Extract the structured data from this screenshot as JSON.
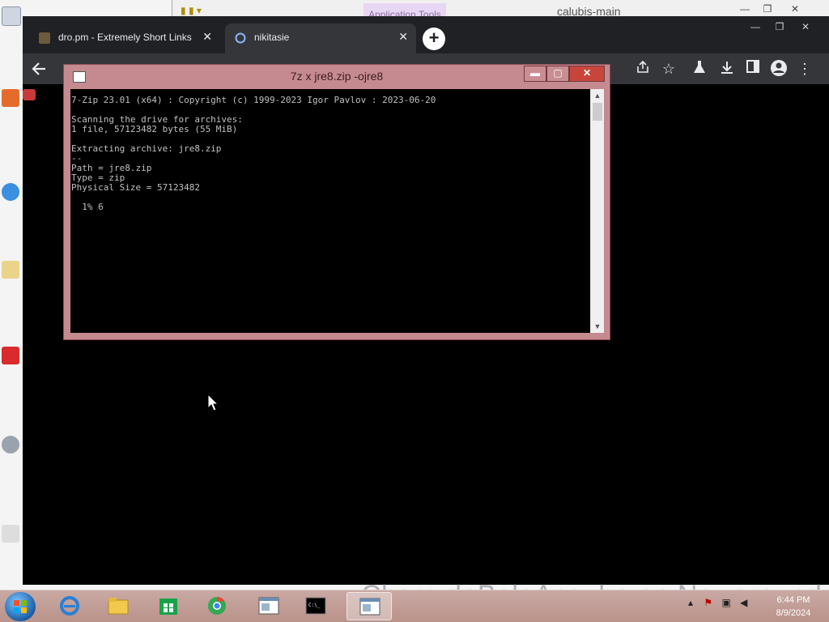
{
  "explorer": {
    "contextual_tab": "Application Tools",
    "title": "calubis-main"
  },
  "browser": {
    "tabs": [
      {
        "title": "dro.pm - Extremely Short Links",
        "active": false
      },
      {
        "title": "nikitasie",
        "active": true
      }
    ],
    "new_tab_symbol": "+",
    "close_symbol": "✕"
  },
  "console_window": {
    "title": "7z  x jre8.zip -ojre8",
    "output": "7-Zip 23.01 (x64) : Copyright (c) 1999-2023 Igor Pavlov : 2023-06-20\n\nScanning the drive for archives:\n1 file, 57123482 bytes (55 MiB)\n\nExtracting archive: jre8.zip\n--\nPath = jre8.zip\nType = zip\nPhysical Size = 57123482\n\n  1% 6"
  },
  "taskbar": {
    "items": [
      "internet-explorer",
      "file-explorer",
      "store",
      "chrome",
      "document-viewer",
      "command-prompt",
      "console-window"
    ],
    "active_item": "console-window",
    "time": "6:44 PM",
    "date": "8/9/2024"
  },
  "watermark": "CherrydoBoloAconha on Newgrounds",
  "colors": {
    "console_frame": "#c58a8f",
    "console_bg": "#000000",
    "console_text": "#c0c0c0",
    "chrome_tabstrip": "#202124",
    "chrome_toolbar": "#35363a",
    "close_button": "#c7463c"
  }
}
